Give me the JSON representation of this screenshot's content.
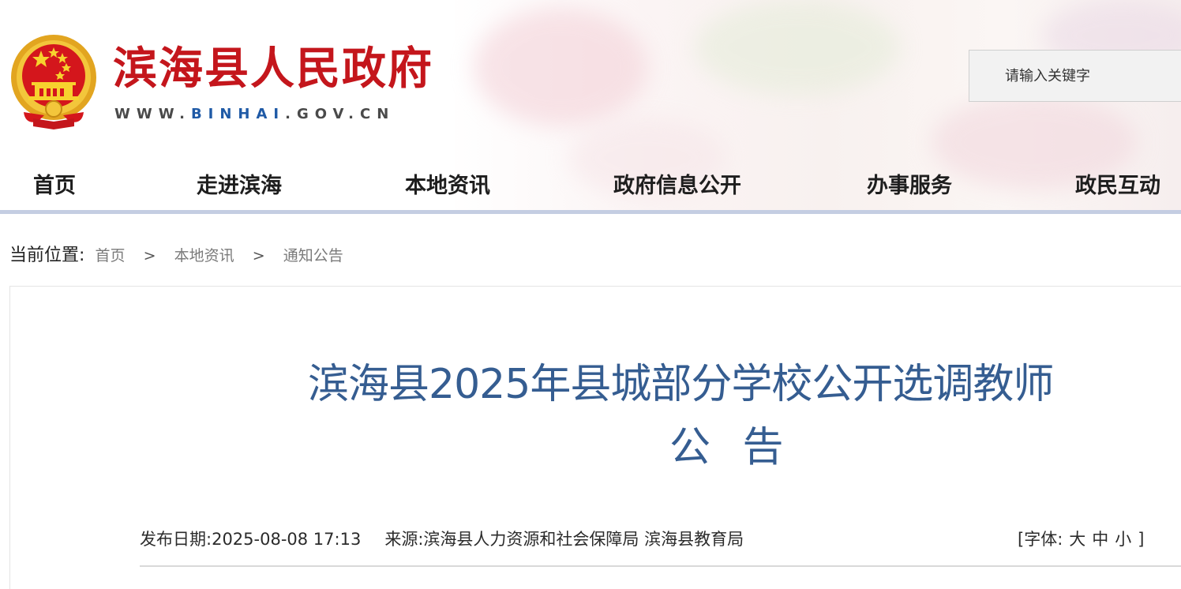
{
  "site": {
    "title": "滨海县人民政府",
    "domain_pre": "WWW.",
    "domain_hl": "BINHAI",
    "domain_post": ".GOV.CN"
  },
  "search": {
    "placeholder": "请输入关键字"
  },
  "nav": {
    "items": [
      {
        "label": "首页"
      },
      {
        "label": "走进滨海"
      },
      {
        "label": "本地资讯"
      },
      {
        "label": "政府信息公开"
      },
      {
        "label": "办事服务"
      },
      {
        "label": "政民互动"
      }
    ]
  },
  "breadcrumb": {
    "label": "当前位置:",
    "items": [
      "首页",
      "本地资讯",
      "通知公告"
    ],
    "separator": ">"
  },
  "article": {
    "title_line1": "滨海县2025年县城部分学校公开选调教师",
    "title_line2": "公 告",
    "date_label": "发布日期:",
    "date_value": "2025-08-08 17:13",
    "source_label": "来源:",
    "source_value": "滨海县人力资源和社会保障局 滨海县教育局",
    "font_label": "[字体:",
    "font_large": "大",
    "font_medium": "中",
    "font_small": "小",
    "font_close": "]"
  },
  "colors": {
    "brand_red": "#c4161c",
    "title_blue": "#355d91",
    "nav_underline": "#c4cde2"
  }
}
